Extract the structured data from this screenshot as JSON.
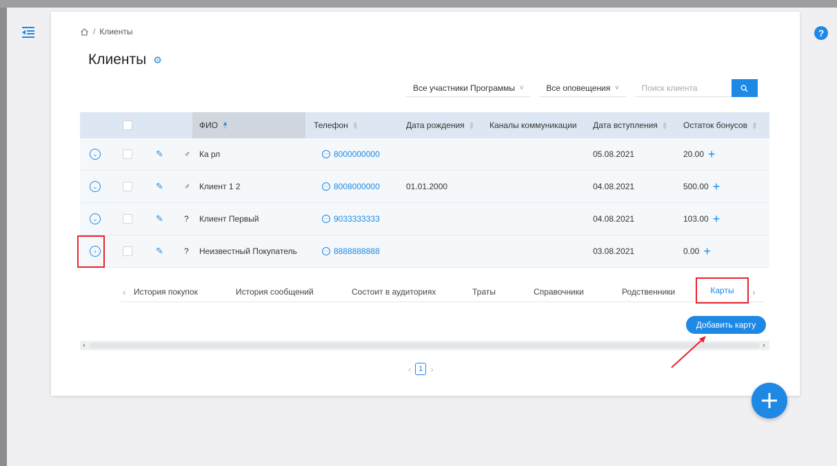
{
  "breadcrumb": {
    "home_icon": "home-icon",
    "separator": "/",
    "current": "Клиенты"
  },
  "page": {
    "title": "Клиенты",
    "settings_icon": "gear-icon"
  },
  "filters": {
    "participants": "Все участники Программы",
    "notifications": "Все оповещения",
    "search_placeholder": "Поиск клиента"
  },
  "table": {
    "headers": {
      "fio": "ФИО",
      "phone": "Телефон",
      "birthdate": "Дата рождения",
      "channels": "Каналы коммуникации",
      "joined": "Дата вступления",
      "bonus": "Остаток бонусов"
    },
    "rows": [
      {
        "gender": "♂",
        "name": "Ка рл",
        "phone": "8000000000",
        "birthdate": "",
        "joined": "05.08.2021",
        "bonus": "20.00"
      },
      {
        "gender": "♂",
        "name": "Клиент 1 2",
        "phone": "8008000000",
        "birthdate": "01.01.2000",
        "joined": "04.08.2021",
        "bonus": "500.00"
      },
      {
        "gender": "?",
        "name": "Клиент Первый",
        "phone": "9033333333",
        "birthdate": "",
        "joined": "04.08.2021",
        "bonus": "103.00"
      },
      {
        "gender": "?",
        "name": "Неизвестный Покупатель",
        "phone": "8888888888",
        "birthdate": "",
        "joined": "03.08.2021",
        "bonus": "0.00"
      }
    ]
  },
  "tabs": [
    {
      "label": "История покупок"
    },
    {
      "label": "История сообщений"
    },
    {
      "label": "Состоит в аудиториях"
    },
    {
      "label": "Траты"
    },
    {
      "label": "Справочники"
    },
    {
      "label": "Родственники"
    },
    {
      "label": "Карты",
      "active": true
    }
  ],
  "add_card_button": "Добавить карту",
  "pagination": {
    "current_page": "1"
  },
  "colors": {
    "accent": "#1e88e5",
    "highlight": "#e8232d"
  }
}
